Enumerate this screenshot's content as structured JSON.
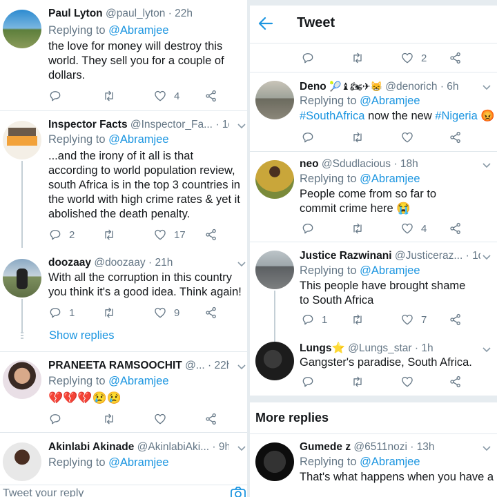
{
  "header": {
    "title": "Tweet"
  },
  "left": {
    "tweets": [
      {
        "name": "Paul Lyton",
        "handle": "@paul_lyton",
        "time": "22h",
        "replying_label": "Replying to",
        "replying_to": "@Abramjee",
        "text": "the love for money will destroy this world. They sell you for a couple of dollars.",
        "likes": "4"
      },
      {
        "name": "Inspector Facts",
        "handle": "@Inspector_Fa...",
        "time": "1d",
        "replying_label": "Replying to",
        "replying_to": "@Abramjee",
        "text": "...and the irony of it all is that according to world population review, south Africa is in the top 3 countries in the world with high crime rates & yet it abolished the death penalty.",
        "replies": "2",
        "likes": "17"
      },
      {
        "name": "doozaay",
        "handle": "@doozaay",
        "time": "21h",
        "text": "With all the corruption in this country you think it's a good idea. Think again!",
        "replies": "1",
        "likes": "9",
        "show_replies": "Show replies"
      },
      {
        "name": "PRANEETA RAMSOOCHIT",
        "handle": "@...",
        "time": "22h",
        "replying_label": "Replying to",
        "replying_to": "@Abramjee",
        "text": "💔💔💔😢😢"
      },
      {
        "name": "Akinlabi Akinade",
        "handle": "@AkinlabiAki...",
        "time": "9h",
        "replying_label": "Replying to",
        "replying_to": "@Abramjee"
      }
    ],
    "compose_placeholder": "Tweet your reply"
  },
  "right": {
    "top_likes": "2",
    "tweets": [
      {
        "name": "Deno",
        "name_emoji": "🎾♝🏍✈😸",
        "handle": "@denorich",
        "time": "6h",
        "replying_label": "Replying to",
        "replying_to": "@Abramjee",
        "tag1": "#SouthAfrica",
        "text_mid": " now the new ",
        "tag2": "#Nigeria",
        "text_end": " 😡"
      },
      {
        "name": "neo",
        "handle": "@Sdudlacious",
        "time": "18h",
        "replying_label": "Replying to",
        "replying_to": "@Abramjee",
        "text": "People come from so far to commit crime here 😭",
        "likes": "4"
      },
      {
        "name": "Justice Razwinani",
        "handle": "@Justiceraz...",
        "time": "1d",
        "replying_label": "Replying to",
        "replying_to": "@Abramjee",
        "text": "This people have brought shame to South Africa",
        "replies": "1",
        "likes": "7"
      },
      {
        "name": "Lungs⭐",
        "handle": "@Lungs_star",
        "time": "1h",
        "text": "Gangster's paradise, South Africa."
      }
    ],
    "more_replies_title": "More replies",
    "more": {
      "name": "Gumede z",
      "handle": "@6511nozi",
      "time": "13h",
      "replying_label": "Replying to",
      "replying_to": "@Abramjee",
      "text": "That's what happens when you have a"
    }
  },
  "colors": {
    "accent": "#1b95e0",
    "muted": "#657786",
    "divider": "#e1e8ed",
    "bg_gap": "#e6ecf0"
  },
  "icons": [
    "back-arrow-icon",
    "chevron-down-icon",
    "reply-icon",
    "retweet-icon",
    "like-icon",
    "share-icon",
    "camera-icon"
  ]
}
